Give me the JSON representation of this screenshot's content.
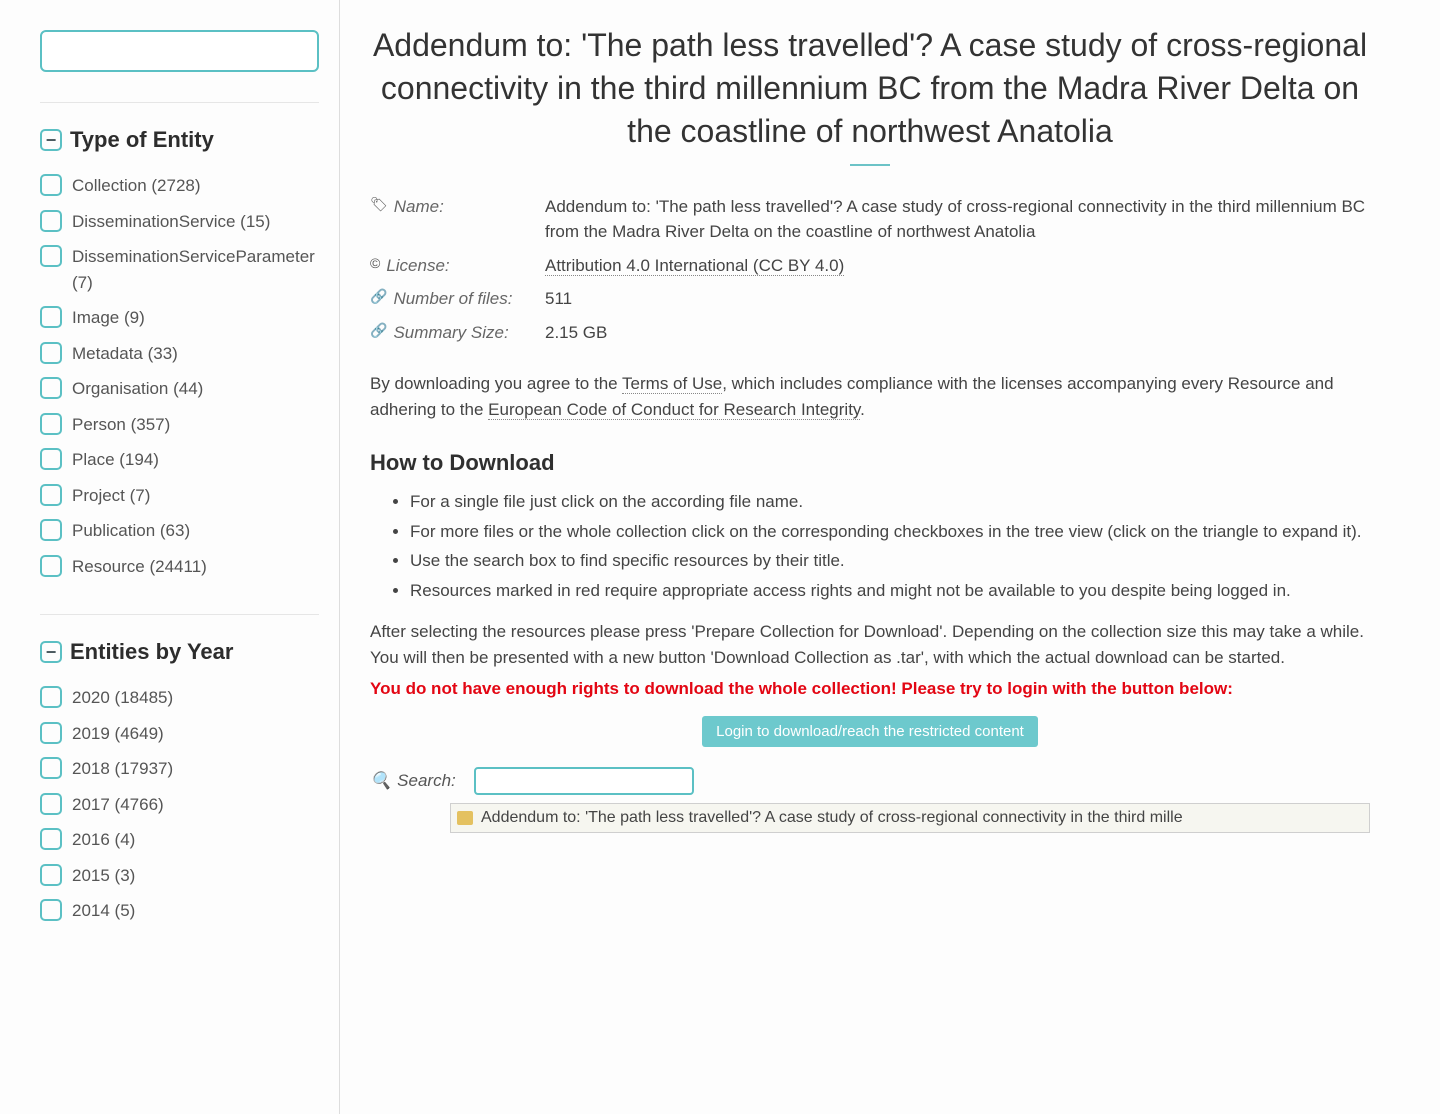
{
  "sidebar": {
    "search_value": "",
    "facets": [
      {
        "title": "Type of Entity",
        "items": [
          {
            "label": "Collection (2728)"
          },
          {
            "label": "DisseminationService (15)"
          },
          {
            "label": "DisseminationServiceParameter (7)"
          },
          {
            "label": "Image (9)"
          },
          {
            "label": "Metadata (33)"
          },
          {
            "label": "Organisation (44)"
          },
          {
            "label": "Person (357)"
          },
          {
            "label": "Place (194)"
          },
          {
            "label": "Project (7)"
          },
          {
            "label": "Publication (63)"
          },
          {
            "label": "Resource (24411)"
          }
        ]
      },
      {
        "title": "Entities by Year",
        "items": [
          {
            "label": "2020 (18485)"
          },
          {
            "label": "2019 (4649)"
          },
          {
            "label": "2018 (17937)"
          },
          {
            "label": "2017 (4766)"
          },
          {
            "label": "2016 (4)"
          },
          {
            "label": "2015 (3)"
          },
          {
            "label": "2014 (5)"
          }
        ]
      }
    ]
  },
  "main": {
    "title": "Addendum to: 'The path less travelled'? A case study of cross-regional connectivity in the third millennium BC from the Madra River Delta on the coastline of northwest Anatolia",
    "meta": {
      "name_label": "Name:",
      "name_value": "Addendum to: 'The path less travelled'? A case study of cross-regional connectivity in the third millennium BC from the Madra River Delta on the coastline of northwest Anatolia",
      "license_label": "License:",
      "license_value": "Attribution 4.0 International (CC BY 4.0)",
      "numfiles_label": "Number of files:",
      "numfiles_value": "511",
      "size_label": "Summary Size:",
      "size_value": "2.15 GB"
    },
    "agree_prefix": "By downloading you agree to the ",
    "terms_link": "Terms of Use",
    "agree_mid": ", which includes compliance with the licenses accompanying every Resource and adhering to the ",
    "code_link": "European Code of Conduct for Research Integrity",
    "agree_suffix": ".",
    "how_heading": "How to Download",
    "how_items": [
      "For a single file just click on the according file name.",
      "For more files or the whole collection click on the corresponding checkboxes in the tree view (click on the triangle to expand it).",
      "Use the search box to find specific resources by their title.",
      "Resources marked in red require appropriate access rights and might not be available to you despite being logged in."
    ],
    "after_text": "After selecting the resources please press 'Prepare Collection for Download'. Depending on the collection size this may take a while. You will then be presented with a new button 'Download Collection as .tar', with which the actual download can be started.",
    "warning_text": "You do not have enough rights to download the whole collection! Please try to login with the button below:",
    "login_button": "Login to download/reach the restricted content",
    "tree_search_label": "Search:",
    "tree_search_value": "",
    "tree_root_label": "Addendum to: 'The path less travelled'? A case study of cross-regional connectivity in the third mille"
  }
}
